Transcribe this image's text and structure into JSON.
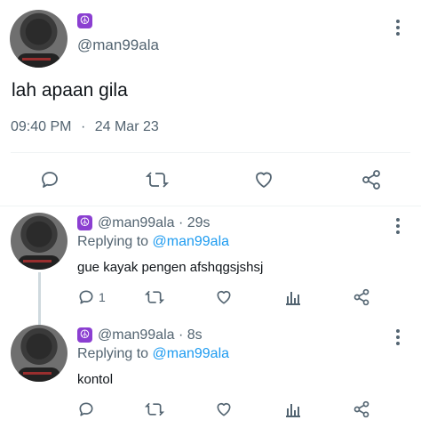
{
  "main_tweet": {
    "handle": "@man99ala",
    "badge_glyph": "☮",
    "text": "lah apaan gila",
    "time": "09:40 PM",
    "separator": "·",
    "date": "24 Mar 23",
    "actions": [
      "reply-icon",
      "retweet-icon",
      "like-icon",
      "share-icon"
    ]
  },
  "replies": [
    {
      "handle": "@man99ala",
      "time_sep": "·",
      "age": "29s",
      "replying_label": "Replying to",
      "replying_to": "@man99ala",
      "text": "gue kayak pengen afshqgsjshsj",
      "reply_count": "1"
    },
    {
      "handle": "@man99ala",
      "time_sep": "·",
      "age": "8s",
      "replying_label": "Replying to",
      "replying_to": "@man99ala",
      "text": "kontol",
      "reply_count": ""
    }
  ],
  "colors": {
    "accent": "#1d9bf0",
    "muted": "#536471",
    "badge": "#8b3fd1"
  }
}
